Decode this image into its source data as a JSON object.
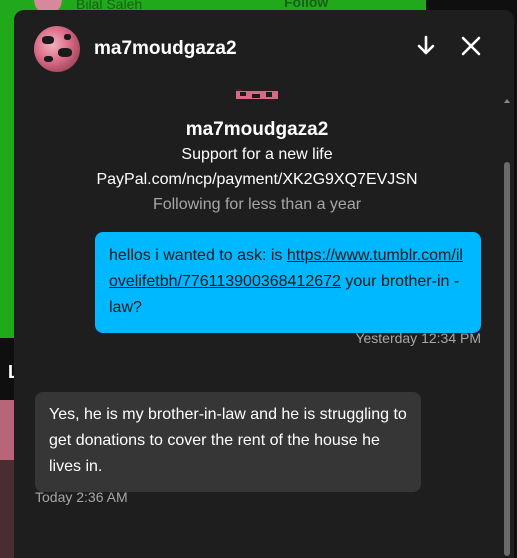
{
  "background": {
    "top_name": "Bilal Saleh",
    "top_follow": "Follow",
    "side_letter": "L",
    "accent_green": "#21a91c"
  },
  "header": {
    "username": "ma7moudgaza2",
    "minimize_icon": "arrow-down-icon",
    "close_icon": "close-icon"
  },
  "profile": {
    "name": "ma7moudgaza2",
    "description": "Support for a new life",
    "link": "PayPal.com/ncp/payment/XK2G9XQ7EVJSN",
    "following": "Following for less than a year"
  },
  "messages": [
    {
      "direction": "outgoing",
      "text_before": "hellos i wanted to ask: is ",
      "link": "https://www.tumblr.com/ilovelifetbh/776113900368412672",
      "text_after": " your brother-in -law?",
      "time": "Yesterday 12:34 PM",
      "color": "#00b8ff"
    },
    {
      "direction": "incoming",
      "text": "Yes, he is my brother-in-law and he is struggling to get donations to cover the rent of the house he lives in.",
      "time": "Today 2:36 AM",
      "color": "#363636"
    }
  ]
}
